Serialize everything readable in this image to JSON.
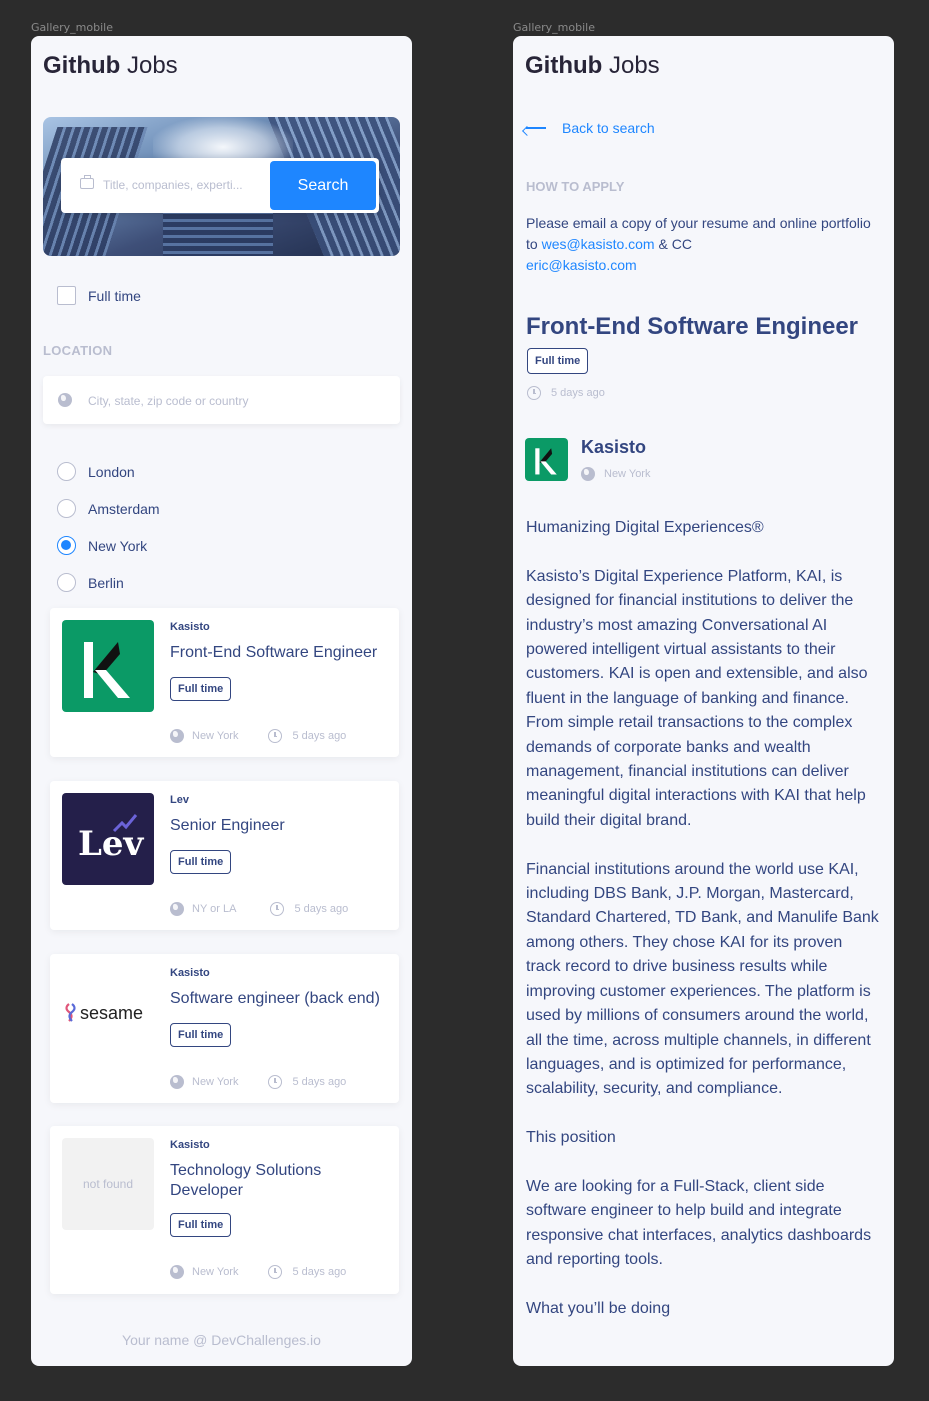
{
  "frames": {
    "label": "Gallery_mobile"
  },
  "brand": {
    "bold": "Github",
    "light": "Jobs"
  },
  "search": {
    "placeholder": "Title, companies, experti...",
    "button_label": "Search"
  },
  "filters": {
    "full_time_label": "Full time",
    "location_heading": "LOCATION",
    "location_placeholder": "City, state, zip code or country",
    "locations": [
      {
        "label": "London",
        "selected": false
      },
      {
        "label": "Amsterdam",
        "selected": false
      },
      {
        "label": "New York",
        "selected": true
      },
      {
        "label": "Berlin",
        "selected": false
      }
    ]
  },
  "jobs": [
    {
      "company": "Kasisto",
      "title": "Front-End Software Engineer",
      "tag": "Full time",
      "location": "New York",
      "posted": "5 days ago",
      "logo": "kasisto-logo"
    },
    {
      "company": "Lev",
      "title": "Senior Engineer",
      "tag": "Full time",
      "location": "NY or LA",
      "posted": "5 days ago",
      "logo": "lev-logo",
      "logo_text": "Lev"
    },
    {
      "company": "Kasisto",
      "title": "Software engineer (back end)",
      "tag": "Full time",
      "location": "New York",
      "posted": "5 days ago",
      "logo": "sesame-logo",
      "logo_text": "sesame"
    },
    {
      "company": "Kasisto",
      "title": "Technology Solutions Developer",
      "tag": "Full time",
      "location": "New York",
      "posted": "5 days ago",
      "logo": "placeholder",
      "logo_text": "not found"
    }
  ],
  "footer": "Your name @ DevChallenges.io",
  "detail": {
    "back_label": "Back to search",
    "how_to_apply_heading": "HOW TO APPLY",
    "apply_text_1": "Please email a copy of your resume and online portfolio to ",
    "apply_email_1": "wes@kasisto.com",
    "apply_text_2": " & CC",
    "apply_email_2": "eric@kasisto.com",
    "title": "Front-End Software Engineer",
    "tag": "Full time",
    "posted": "5 days ago",
    "company": "Kasisto",
    "location": "New York",
    "paragraphs": [
      "Humanizing Digital Experiences®",
      "Kasisto’s Digital Experience Platform, KAI, is designed for financial institutions to deliver the industry’s most amazing Conversational AI powered intelligent virtual assistants to their customers. KAI is open and extensible, and also fluent in the language of banking and finance. From simple retail transactions to the complex demands of corporate banks and wealth management, financial institutions can deliver meaningful digital interactions with KAI that help build their digital brand.",
      "Financial institutions around the world use KAI, including DBS Bank, J.P. Morgan, Mastercard, Standard Chartered, TD Bank, and Manulife Bank among others. They chose KAI for its proven track record to drive business results while improving customer experiences. The platform is used by millions of consumers around the world, all the time, across multiple channels, in different languages, and is optimized for performance, scalability, security, and compliance.",
      "This position",
      "We are looking for a Full-Stack, client side software engineer to help build and integrate responsive chat interfaces, analytics dashboards and reporting tools.",
      "What you’ll be doing"
    ]
  },
  "colors": {
    "accent": "#1e86ff",
    "text": "#334680",
    "muted": "#b9bdcf",
    "kasisto_green": "#0b9a66",
    "lev_navy": "#241f4a"
  }
}
